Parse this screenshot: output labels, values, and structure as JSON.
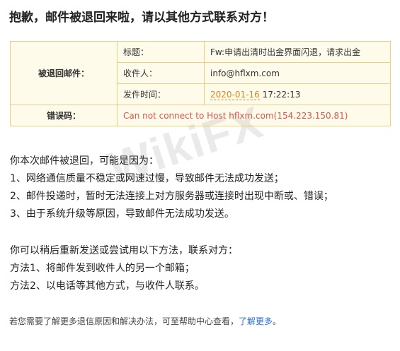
{
  "page_title": "抱歉，邮件被退回来啦，请以其他方式联系对方！",
  "bounce_table": {
    "bounced_mail_label": "被退回邮件：",
    "subject_label": "标题：",
    "subject_value": "Fw:申请出清时出金界面闪退，请求出金",
    "recipient_label": "收件人：",
    "recipient_value": "info@hflxm.com",
    "sent_time_label": "发件时间：",
    "sent_date": "2020-01-16",
    "sent_time": "17:22:13",
    "error_label": "错误码：",
    "error_value": "Can not connect to Host hflxm.com(154.223.150.81)"
  },
  "reasons": {
    "intro": "你本次邮件被退回，可能是因为：",
    "items": [
      "1、网络通信质量不稳定或网速过慢，导致邮件无法成功发送；",
      "2、邮件投递时，暂时无法连接上对方服务器或连接时出现中断或、错误；",
      "3、由于系统升级等原因，导致邮件无法成功发送。"
    ]
  },
  "suggestions": {
    "intro": "你可以稍后重新发送或尝试用以下方法，联系对方：",
    "items": [
      "方法1、将邮件发到收件人的另一个邮箱；",
      "方法2、以电话等其他方式，与收件人联系。"
    ]
  },
  "footer": {
    "text": "若您需要了解更多退信原因和解决办法，可至帮助中心查看，",
    "link": "了解更多",
    "end": "。"
  },
  "watermark": "WikiFX",
  "colors": {
    "table_bg": "#fffbea",
    "table_border": "#e8d08a",
    "error": "#d9534f",
    "link": "#2b6cd8",
    "date": "#d9861c"
  }
}
